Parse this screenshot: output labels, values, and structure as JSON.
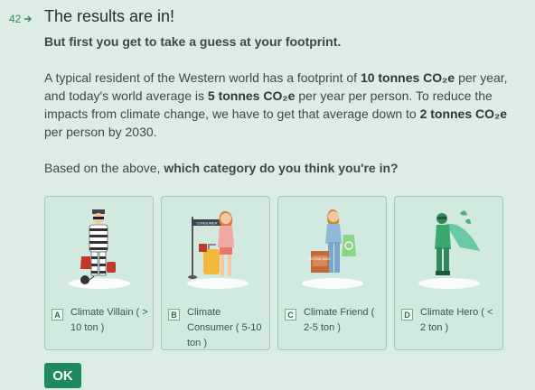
{
  "question": {
    "number": "42",
    "title": "The results are in!",
    "subtitle": "But first you get to take a guess at your footprint."
  },
  "paragraph": {
    "p1": "A typical resident of the Western world has a footprint of ",
    "b1": "10 tonnes CO₂e",
    "p2": " per year, and today's world average is ",
    "b2": "5 tonnes CO₂e",
    "p3": " per year per person. To reduce the impacts from climate change, we have to get that average down to ",
    "b3": "2 tonnes CO₂e",
    "p4": " per person by 2030."
  },
  "prompt": {
    "lead": "Based on the above, ",
    "bold": "which category do you think you're in?"
  },
  "options": [
    {
      "key": "A",
      "label": "Climate Villain ( > 10 ton )"
    },
    {
      "key": "B",
      "label": "Climate Consumer ( 5-10 ton )"
    },
    {
      "key": "C",
      "label": "Climate Friend ( 2-5 ton )"
    },
    {
      "key": "D",
      "label": "Climate Hero ( < 2 ton )"
    }
  ],
  "art_text": {
    "sign": "CONSUMER",
    "box": "SECOND HAND"
  },
  "ok_label": "OK",
  "colors": {
    "background": "#dcede6",
    "card": "#d2e9df",
    "accent": "#1f8a5e"
  }
}
